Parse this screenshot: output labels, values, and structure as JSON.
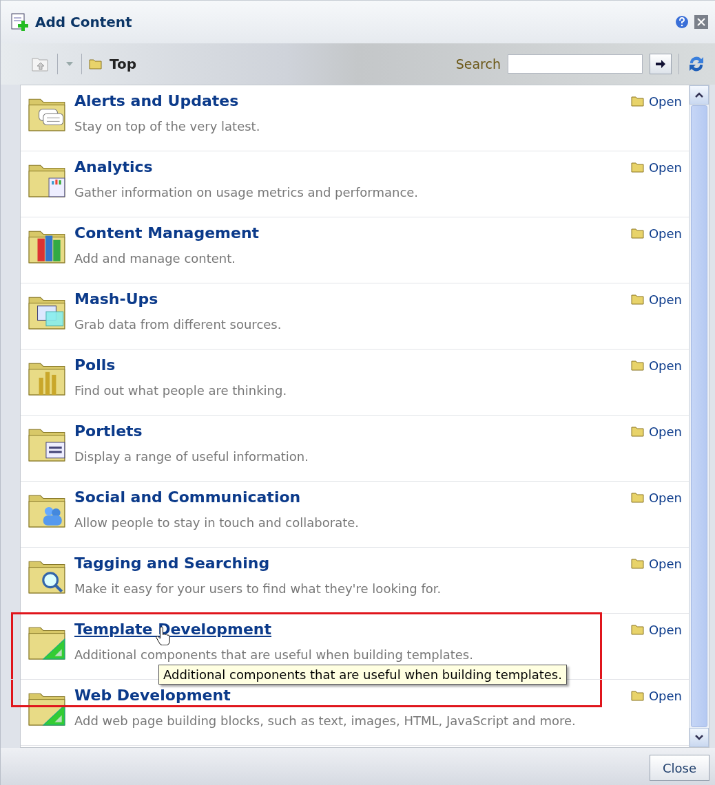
{
  "dialog": {
    "title": "Add Content"
  },
  "toolbar": {
    "breadcrumb": "Top",
    "search_label": "Search"
  },
  "items": [
    {
      "title": "Alerts and Updates",
      "description": "Stay on top of the very latest.",
      "action": "Open",
      "hovered": false,
      "highlighted": false
    },
    {
      "title": "Analytics",
      "description": "Gather information on usage metrics and performance.",
      "action": "Open",
      "hovered": false,
      "highlighted": false
    },
    {
      "title": "Content Management",
      "description": "Add and manage content.",
      "action": "Open",
      "hovered": false,
      "highlighted": false
    },
    {
      "title": "Mash-Ups",
      "description": "Grab data from different sources.",
      "action": "Open",
      "hovered": false,
      "highlighted": false
    },
    {
      "title": "Polls",
      "description": "Find out what people are thinking.",
      "action": "Open",
      "hovered": false,
      "highlighted": false
    },
    {
      "title": "Portlets",
      "description": "Display a range of useful information.",
      "action": "Open",
      "hovered": false,
      "highlighted": false
    },
    {
      "title": "Social and Communication",
      "description": "Allow people to stay in touch and collaborate.",
      "action": "Open",
      "hovered": false,
      "highlighted": false
    },
    {
      "title": "Tagging and Searching",
      "description": "Make it easy for your users to find what they're looking for.",
      "action": "Open",
      "hovered": false,
      "highlighted": false
    },
    {
      "title": "Template Development",
      "description": "Additional components that are useful when building templates.",
      "action": "Open",
      "hovered": true,
      "highlighted": true,
      "tooltip": "Additional components that are useful when building templates."
    },
    {
      "title": "Web Development",
      "description": "Add web page building blocks, such as text, images, HTML, JavaScript and more.",
      "action": "Open",
      "hovered": false,
      "highlighted": true
    }
  ],
  "footer": {
    "button": "Close"
  }
}
